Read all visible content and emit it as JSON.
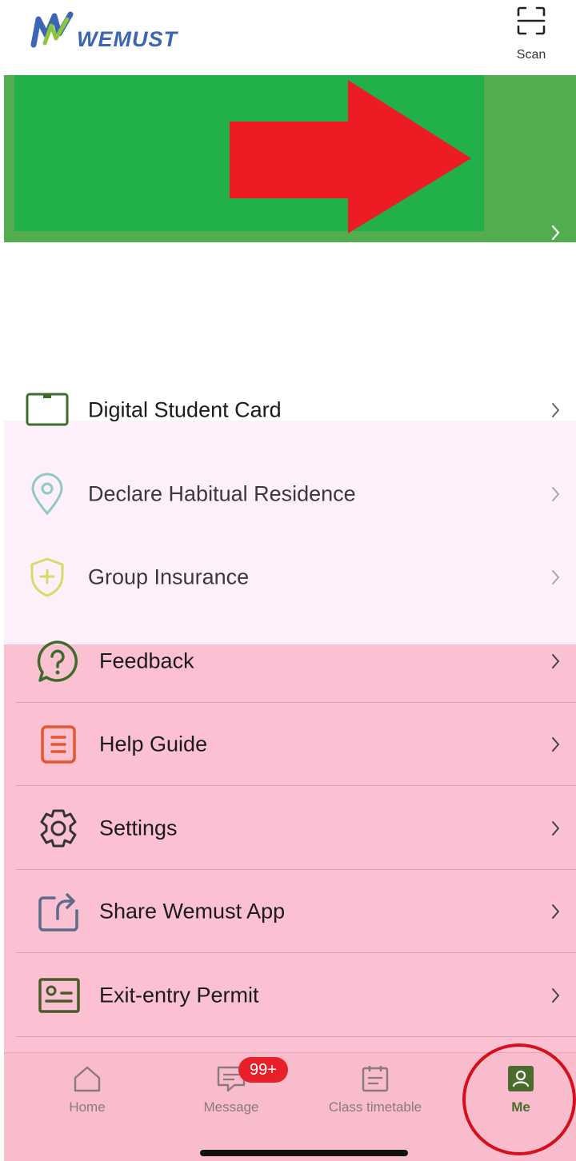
{
  "header": {
    "logo_text": "WEMUST",
    "scan_label": "Scan"
  },
  "banner": {
    "chevron": "›"
  },
  "menu": [
    {
      "label": "Digital Student Card",
      "icon": "student-card-icon"
    },
    {
      "label": "Declare Habitual Residence",
      "icon": "location-pin-icon"
    },
    {
      "label": "Group Insurance",
      "icon": "shield-plus-icon"
    },
    {
      "label": "Feedback",
      "icon": "question-bubble-icon"
    },
    {
      "label": "Help Guide",
      "icon": "document-list-icon"
    },
    {
      "label": "Settings",
      "icon": "gear-icon"
    },
    {
      "label": "Share Wemust App",
      "icon": "share-icon"
    },
    {
      "label": "Exit-entry Permit",
      "icon": "id-card-icon"
    }
  ],
  "tabs": [
    {
      "label": "Home",
      "icon": "home-icon"
    },
    {
      "label": "Message",
      "icon": "message-icon",
      "badge": "99+"
    },
    {
      "label": "Class timetable",
      "icon": "calendar-icon"
    },
    {
      "label": "Me",
      "icon": "profile-icon",
      "active": true
    }
  ],
  "colors": {
    "banner_green": "#22b04b",
    "banner_outer": "#52ad4f",
    "arrow_red": "#ed1c24",
    "menu_pink": "#fbc1d3",
    "menu_light": "#fdf0fa",
    "active_tab": "#4a6c2c",
    "badge_red": "#e8202a"
  }
}
